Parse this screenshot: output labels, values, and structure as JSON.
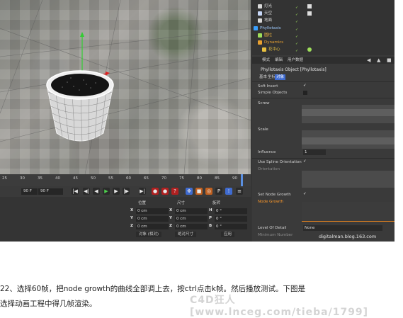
{
  "object_manager": {
    "items": [
      {
        "label": "灯光",
        "color": "#d8d8d8"
      },
      {
        "label": "天空",
        "color": "#c8d8f8"
      },
      {
        "label": "地面",
        "color": "#d8d8d8"
      },
      {
        "label": "Phyllotaxis",
        "color": "#3aa0ff"
      },
      {
        "label": "圆柱",
        "color": "#9ede5b"
      },
      {
        "label": "Dynamics",
        "color": "#e8a030"
      },
      {
        "label": "花中心",
        "color": "#e8c040"
      }
    ],
    "check": "✓"
  },
  "attributes": {
    "tabs": [
      "模式",
      "编辑",
      "用户数据"
    ],
    "object_title": "Phyllotaxis Object [Phyllotaxis]",
    "subtabs": [
      "基本",
      "坐标",
      "对象"
    ],
    "properties": {
      "soft_insert": "Soft Insert",
      "simple_objects": "Simple Objects",
      "screw": "Screw",
      "scale": "Scale",
      "influence": "Influence",
      "influence_value": "1",
      "use_spline_orientation": "Use Spline Orientation",
      "orientation": "Orientation",
      "set_node_growth": "Set Node Growth",
      "node_growth": "Node Growth",
      "level_of_detail": "Level Of Detail",
      "level_of_detail_value": "None",
      "minimum_number": "Minimum Number"
    },
    "check": "✓"
  },
  "timeline": {
    "ticks": [
      "25",
      "30",
      "35",
      "40",
      "45",
      "50",
      "55",
      "60",
      "65",
      "70",
      "75",
      "80",
      "85",
      "90"
    ],
    "current_frame": "90 F",
    "end_frame": "90 F"
  },
  "coordinates": {
    "headers": [
      "位置",
      "尺寸",
      "旋转"
    ],
    "rows": [
      {
        "pos_label": "X",
        "pos": "0 cm",
        "size_label": "X",
        "size": "0 cm",
        "rot_label": "H",
        "rot": "0 °"
      },
      {
        "pos_label": "Y",
        "pos": "0 cm",
        "size_label": "Y",
        "size": "0 cm",
        "rot_label": "P",
        "rot": "0 °"
      },
      {
        "pos_label": "Z",
        "pos": "0 cm",
        "size_label": "Z",
        "size": "0 cm",
        "rot_label": "B",
        "rot": "0 °"
      }
    ],
    "object_mode": "对象 (相对)",
    "size_mode": "绝对尺寸",
    "apply": "应用"
  },
  "watermark": "digitalman.blog.163.com",
  "caption": {
    "line1": "22、选择60帧，把node growth的曲线全部调上去，按ctrl点击k帧。然后播放测试。下图是",
    "line2": "选择动画工程中得几帧渲染。"
  },
  "logo_text": "C4D狂人 [www.lnceg.com/tieba/1799]"
}
